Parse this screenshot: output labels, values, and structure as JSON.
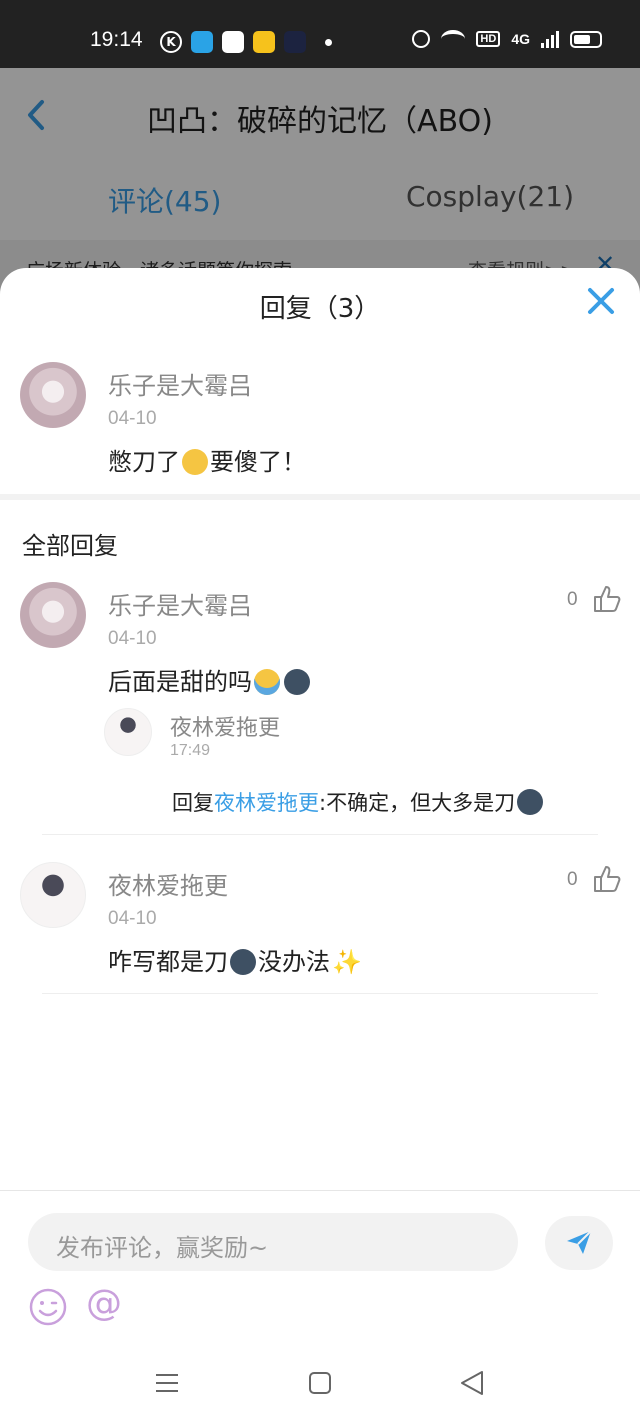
{
  "status_bar": {
    "time": "19:14",
    "icons": [
      "k-icon",
      "telegram-icon",
      "pin-icon",
      "yellow-app-icon",
      "dark-app-icon",
      "dot-icon",
      "alarm-icon",
      "wifi-icon",
      "hd-icon",
      "signal-4g-icon",
      "battery-icon"
    ],
    "hd": "HD",
    "net": "4G"
  },
  "background_page": {
    "title": "凹凸：破碎的记忆（ABO)",
    "tabs": [
      {
        "label": "评论(45)",
        "active": true
      },
      {
        "label": "Cosplay(21)",
        "active": false
      }
    ],
    "notice": {
      "text": "广场新体验，诸多话题等你探索~",
      "rule_link": "查看规则>>",
      "close": "✕"
    }
  },
  "sheet": {
    "title": "回复（3）",
    "close_icon": "close-icon",
    "original_comment": {
      "name": "乐子是大霉吕",
      "date": "04-10",
      "text_before": "憋刀了",
      "emoji": "upside-down-face",
      "text_after": "要傻了！"
    },
    "section_title": "全部回复",
    "replies": [
      {
        "name": "乐子是大霉吕",
        "date": "04-10",
        "text": "后面是甜的吗",
        "emojis": [
          "loudly-crying-face",
          "new-moon-face"
        ],
        "likes": "0",
        "sub_reply": {
          "name": "夜林爱拖更",
          "time": "17:49",
          "prefix": "回复",
          "target": "夜林爱拖更",
          "colon": ":",
          "text": "不确定，但大多是刀",
          "emoji": "new-moon-face"
        }
      },
      {
        "name": "夜林爱拖更",
        "date": "04-10",
        "text_before": "咋写都是刀",
        "emoji": "new-moon-face",
        "text_after": "没办法",
        "emoji2": "✨",
        "likes": "0"
      }
    ]
  },
  "input": {
    "placeholder": "发布评论，赢奖励~",
    "at_symbol": "@"
  },
  "colors": {
    "accent": "#3a9ee5",
    "name_gray": "#888888",
    "emoji_purple": "#c9a0dc"
  }
}
